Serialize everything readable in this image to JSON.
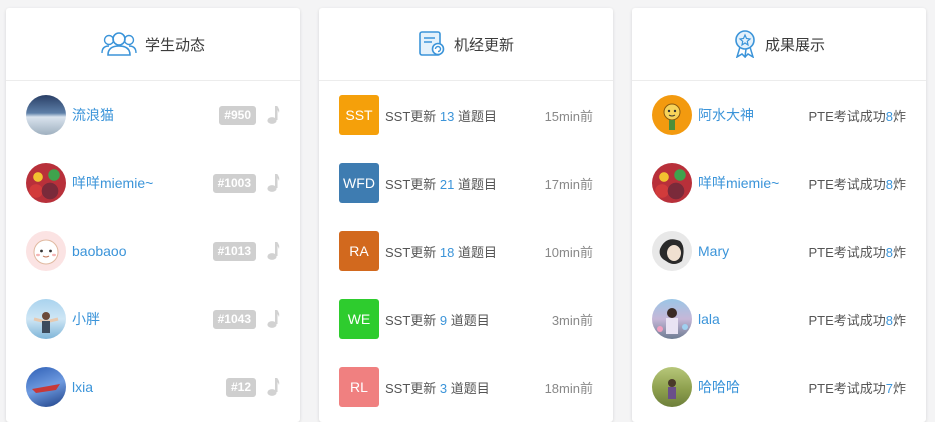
{
  "students": {
    "title": "学生动态",
    "rows": [
      {
        "name": "流浪猫",
        "badge": "#950"
      },
      {
        "name": "咩咩miemie~",
        "badge": "#1003"
      },
      {
        "name": "baobaoo",
        "badge": "#1013"
      },
      {
        "name": "小胖",
        "badge": "#1043"
      },
      {
        "name": "lxia",
        "badge": "#12"
      }
    ]
  },
  "updates": {
    "title": "机经更新",
    "rows": [
      {
        "tag": "SST",
        "color": "#f5a00a",
        "prefix": "SST更新",
        "count": "13",
        "suffix": "道题目",
        "time": "15min前"
      },
      {
        "tag": "WFD",
        "color": "#3e7cb1",
        "prefix": "SST更新",
        "count": "21",
        "suffix": "道题目",
        "time": "17min前"
      },
      {
        "tag": "RA",
        "color": "#d2691e",
        "prefix": "SST更新",
        "count": "18",
        "suffix": "道题目",
        "time": "10min前"
      },
      {
        "tag": "WE",
        "color": "#2ecc2e",
        "prefix": "SST更新",
        "count": "9",
        "suffix": "道题目",
        "time": "3min前"
      },
      {
        "tag": "RL",
        "color": "#f08080",
        "prefix": "SST更新",
        "count": "3",
        "suffix": "道题目",
        "time": "18min前"
      }
    ]
  },
  "achievements": {
    "title": "成果展示",
    "rows": [
      {
        "name": "阿水大神",
        "prefix": "PTE考试成功",
        "count": "8",
        "suffix": "炸"
      },
      {
        "name": "咩咩miemie~",
        "prefix": "PTE考试成功",
        "count": "8",
        "suffix": "炸"
      },
      {
        "name": "Mary",
        "prefix": "PTE考试成功",
        "count": "8",
        "suffix": "炸"
      },
      {
        "name": "lala",
        "prefix": "PTE考试成功",
        "count": "8",
        "suffix": "炸"
      },
      {
        "name": "哈哈哈",
        "prefix": "PTE考试成功",
        "count": "7",
        "suffix": "炸"
      }
    ]
  },
  "colors": {
    "accent": "#3b94d9",
    "badge": "#cfcfcf"
  }
}
